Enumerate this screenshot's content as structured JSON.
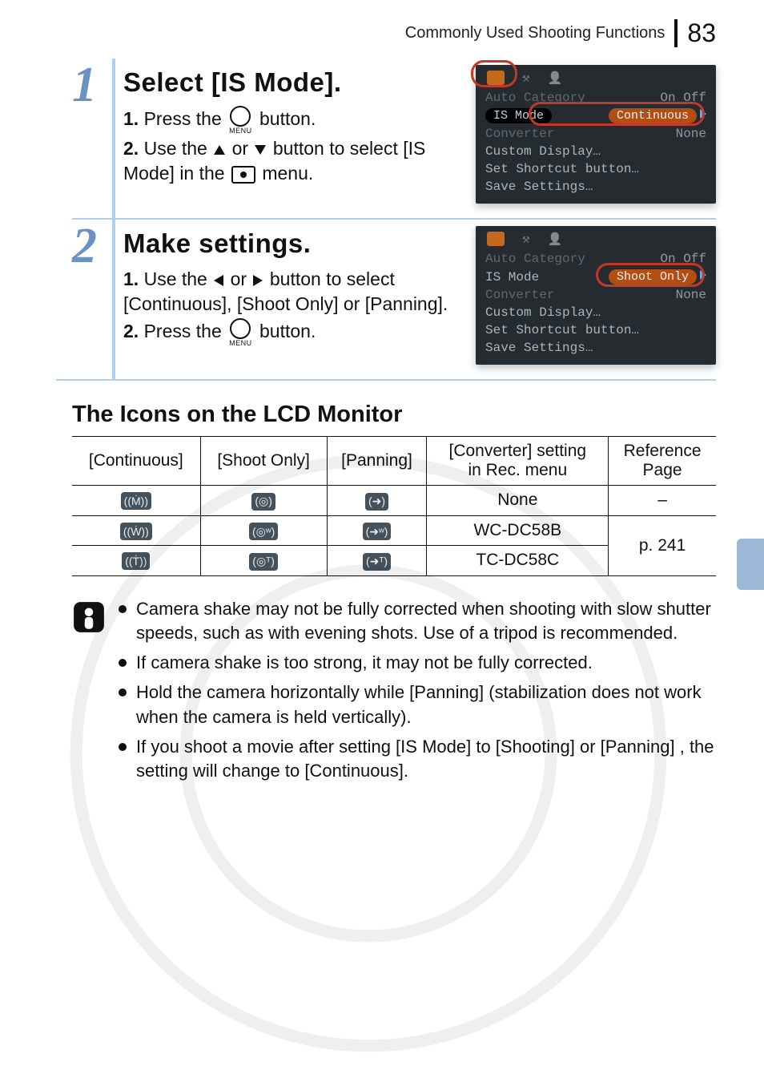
{
  "header": {
    "section": "Commonly Used Shooting Functions",
    "page_number": "83"
  },
  "steps": [
    {
      "num": "1",
      "title": "Select [IS Mode].",
      "sub": [
        {
          "n": "1.",
          "pre": "Press the ",
          "post": " button."
        },
        {
          "n": "2.",
          "pre": "Use the ",
          "mid": " or ",
          "mid2": " button to select [IS Mode] in the ",
          "post": " menu."
        }
      ],
      "cam": {
        "rows": [
          {
            "label": "Auto Category",
            "value": "On Off",
            "dim": true
          },
          {
            "label": "IS Mode",
            "value_pill": "Continuous",
            "highlight": true
          },
          {
            "label": "Converter",
            "value": "None",
            "dim": true
          },
          {
            "label": "Custom Display…"
          },
          {
            "label": "Set Shortcut button…"
          },
          {
            "label": "Save Settings…"
          }
        ]
      }
    },
    {
      "num": "2",
      "title": "Make settings.",
      "sub": [
        {
          "n": "1.",
          "pre": "Use the ",
          "mid": " or ",
          "post": " button to select [Continuous], [Shoot Only] or [Panning]."
        },
        {
          "n": "2.",
          "pre": "Press the ",
          "post": " button."
        }
      ],
      "cam": {
        "rows": [
          {
            "label": "Auto Category",
            "value": "On Off",
            "dim": true
          },
          {
            "label": "IS Mode",
            "value_pill": "Shoot Only",
            "highlight": true
          },
          {
            "label": "Converter",
            "value": "None",
            "dim": true
          },
          {
            "label": "Custom Display…"
          },
          {
            "label": "Set Shortcut button…"
          },
          {
            "label": "Save Settings…"
          }
        ]
      }
    }
  ],
  "section_heading": "The Icons on the LCD Monitor",
  "table": {
    "headers": [
      "[Continuous]",
      "[Shoot Only]",
      "[Panning]",
      "[Converter] setting\nin Rec. menu",
      "Reference\nPage"
    ],
    "rows": [
      {
        "conv": "None",
        "ref": "–"
      },
      {
        "conv": "WC-DC58B",
        "ref_rowspan_start": true,
        "ref": "p. 241"
      },
      {
        "conv": "TC-DC58C"
      }
    ]
  },
  "notes": [
    "Camera shake may not be fully corrected when shooting with slow shutter speeds, such as with evening shots. Use of a tripod is recommended.",
    "If camera shake is too strong, it may not be fully corrected.",
    "Hold the camera horizontally while [Panning] (stabilization does not work when the camera is held vertically).",
    "If you shoot a movie after setting [IS Mode] to [Shooting] or [Panning] , the setting will change to [Continuous]."
  ]
}
